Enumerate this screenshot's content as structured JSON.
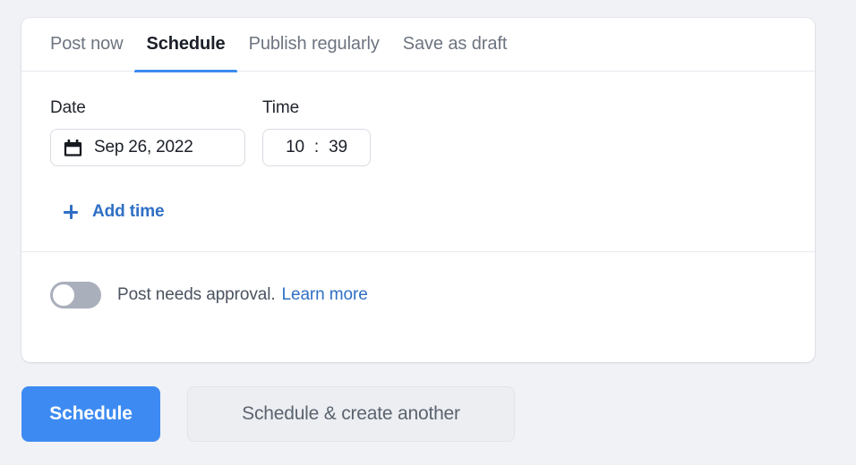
{
  "tabs": [
    {
      "label": "Post now",
      "active": false
    },
    {
      "label": "Schedule",
      "active": true
    },
    {
      "label": "Publish regularly",
      "active": false
    },
    {
      "label": "Save as draft",
      "active": false
    }
  ],
  "schedule": {
    "date_label": "Date",
    "date_value": "Sep 26, 2022",
    "date_icon": "calendar-icon",
    "time_label": "Time",
    "time_hour": "10",
    "time_separator": ":",
    "time_minute": "39",
    "add_time_label": "Add time",
    "add_time_icon": "plus-icon"
  },
  "approval": {
    "toggle_on": false,
    "text": "Post needs approval.",
    "link_label": "Learn more"
  },
  "footer": {
    "primary_label": "Schedule",
    "secondary_label": "Schedule & create another"
  },
  "colors": {
    "page_background": "#f1f2f6",
    "card_background": "#ffffff",
    "accent_blue": "#3d8bf2",
    "link_blue": "#2f6fc4",
    "toggle_track": "#a9afbb",
    "secondary_button": "#eceef1",
    "divider": "#e8e9ee"
  }
}
